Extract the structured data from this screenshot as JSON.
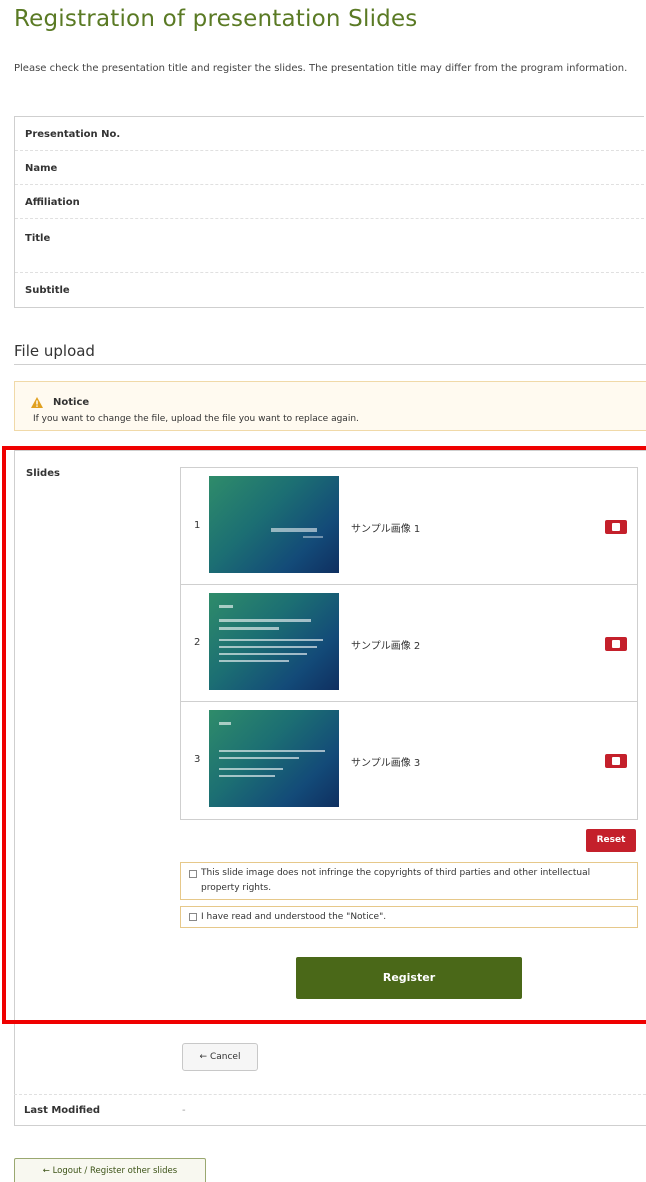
{
  "page": {
    "title": "Registration of presentation Slides",
    "intro": "Please check the presentation title and register the slides. The presentation title may differ from the program information."
  },
  "info_table": {
    "rows": [
      {
        "label": "Presentation No.",
        "value": ""
      },
      {
        "label": "Name",
        "value": ""
      },
      {
        "label": "Affiliation",
        "value": ""
      },
      {
        "label": "Title",
        "value": ""
      },
      {
        "label": "Subtitle",
        "value": ""
      }
    ]
  },
  "file_upload": {
    "section_title": "File upload",
    "notice_title": "Notice",
    "notice_text": "If you want to change the file, upload the file you want to replace again.",
    "slides_label": "Slides",
    "slides": [
      {
        "number": "1",
        "name": "サンプル画像 1"
      },
      {
        "number": "2",
        "name": "サンプル画像 2"
      },
      {
        "number": "3",
        "name": "サンプル画像 3"
      }
    ],
    "reset_label": "Reset",
    "checks": [
      {
        "label": "This slide image does not infringe the copyrights of third parties and other intellectual property rights.",
        "checked": false
      },
      {
        "label": "I have read and understood the \"Notice\".",
        "checked": false
      }
    ],
    "register_label": "Register",
    "cancel_label": "← Cancel"
  },
  "last_modified": {
    "label": "Last Modified",
    "value": "-"
  },
  "footer": {
    "logout_label": "← Logout / Register other slides"
  },
  "colors": {
    "title_green": "#5a7a24",
    "register_green": "#4a6818",
    "delete_red": "#c4202b",
    "highlight_red": "#ef0000",
    "notice_bg": "#fffaf0"
  }
}
